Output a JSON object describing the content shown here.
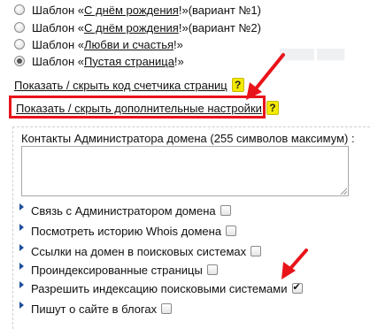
{
  "templates": [
    {
      "prefix": "Шаблон «",
      "link": "С днём рождения",
      "suffix": "!»(вариант №1)",
      "checked": false
    },
    {
      "prefix": "Шаблон «",
      "link": "С днём рождения",
      "suffix": "!»(вариант №2)",
      "checked": false
    },
    {
      "prefix": "Шаблон «",
      "link": "Любви и счастья",
      "suffix": "!»",
      "checked": false
    },
    {
      "prefix": "Шаблон «",
      "link": "Пустая страница",
      "suffix": "!»",
      "checked": true
    }
  ],
  "toggles": {
    "counter_code": "Показать / скрыть код счетчика страниц",
    "extra_settings": "Показать / скрыть дополнительные настройки",
    "help_glyph": "?"
  },
  "contacts": {
    "label": "Контакты Администратора домена (255 символов максимум) :",
    "value": ""
  },
  "options": [
    {
      "label": "Связь с Администратором домена",
      "checked": false
    },
    {
      "label": "Посмотреть историю Whois домена",
      "checked": false
    },
    {
      "label": "Ссылки на домен в поисковых системах",
      "checked": false
    },
    {
      "label": "Проиндексированные страницы",
      "checked": false
    },
    {
      "label": "Разрешить индексацию поисковыми системами",
      "checked": true
    },
    {
      "label": "Пишут о сайте в блогах",
      "checked": false
    }
  ],
  "colors": {
    "highlight": "#e8141a",
    "help_badge": "#f3ea00",
    "bullet": "#1d4f9c"
  }
}
